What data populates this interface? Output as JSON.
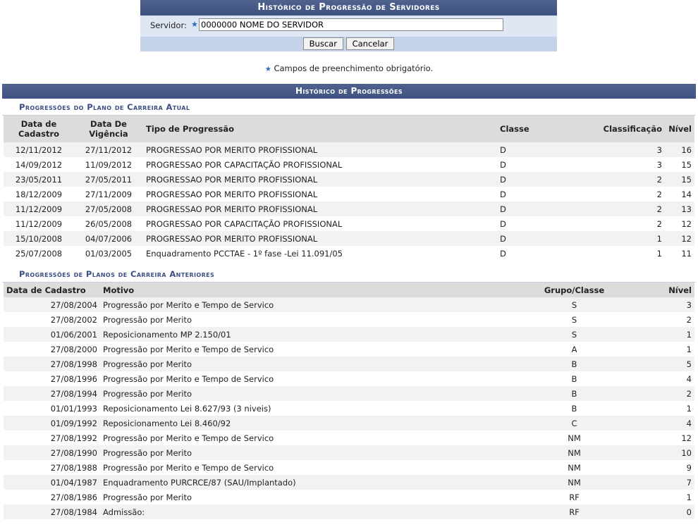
{
  "form": {
    "title": "Histórico de Progressão de Servidores",
    "servidor_label": "Servidor:",
    "servidor_value": "0000000 NOME DO SERVIDOR",
    "buscar_label": "Buscar",
    "cancelar_label": "Cancelar"
  },
  "required_note": "Campos de preenchimento obrigatório.",
  "panel": {
    "title": "Histórico de Progressões"
  },
  "atual": {
    "title": "Progressões do Plano de Carreira Atual",
    "headers": {
      "cadastro": "Data de Cadastro",
      "vigencia": "Data De Vigência",
      "tipo": "Tipo de Progressão",
      "classe": "Classe",
      "classificacao": "Classificação",
      "nivel": "Nível"
    },
    "rows": [
      {
        "cadastro": "12/11/2012",
        "vigencia": "27/11/2012",
        "tipo": "PROGRESSAO POR MERITO PROFISSIONAL",
        "classe": "D",
        "classificacao": "3",
        "nivel": "16"
      },
      {
        "cadastro": "14/09/2012",
        "vigencia": "11/09/2012",
        "tipo": "PROGRESSAO POR CAPACITAÇÃO PROFISSIONAL",
        "classe": "D",
        "classificacao": "3",
        "nivel": "15"
      },
      {
        "cadastro": "23/05/2011",
        "vigencia": "27/05/2011",
        "tipo": "PROGRESSAO POR MERITO PROFISSIONAL",
        "classe": "D",
        "classificacao": "2",
        "nivel": "15"
      },
      {
        "cadastro": "18/12/2009",
        "vigencia": "27/11/2009",
        "tipo": "PROGRESSAO POR MERITO PROFISSIONAL",
        "classe": "D",
        "classificacao": "2",
        "nivel": "14"
      },
      {
        "cadastro": "11/12/2009",
        "vigencia": "27/05/2008",
        "tipo": "PROGRESSAO POR MERITO PROFISSIONAL",
        "classe": "D",
        "classificacao": "2",
        "nivel": "13"
      },
      {
        "cadastro": "11/12/2009",
        "vigencia": "26/05/2008",
        "tipo": "PROGRESSAO POR CAPACITAÇÃO PROFISSIONAL",
        "classe": "D",
        "classificacao": "2",
        "nivel": "12"
      },
      {
        "cadastro": "15/10/2008",
        "vigencia": "04/07/2006",
        "tipo": "PROGRESSAO POR MERITO PROFISSIONAL",
        "classe": "D",
        "classificacao": "1",
        "nivel": "12"
      },
      {
        "cadastro": "25/07/2008",
        "vigencia": "01/03/2005",
        "tipo": "Enquadramento PCCTAE - 1º fase -Lei 11.091/05",
        "classe": "D",
        "classificacao": "1",
        "nivel": "11"
      }
    ]
  },
  "anteriores": {
    "title": "Progressões de Planos de Carreira Anteriores",
    "headers": {
      "cadastro": "Data de Cadastro",
      "motivo": "Motivo",
      "grupo": "Grupo/Classe",
      "nivel": "Nível"
    },
    "rows": [
      {
        "cadastro": "27/08/2004",
        "motivo": "Progressão por Merito e Tempo de Servico",
        "grupo": "S",
        "nivel": "3"
      },
      {
        "cadastro": "27/08/2002",
        "motivo": "Progressão por Merito",
        "grupo": "S",
        "nivel": "2"
      },
      {
        "cadastro": "01/06/2001",
        "motivo": "Reposicionamento MP 2.150/01",
        "grupo": "S",
        "nivel": "1"
      },
      {
        "cadastro": "27/08/2000",
        "motivo": "Progressão por Merito e Tempo de Servico",
        "grupo": "A",
        "nivel": "1"
      },
      {
        "cadastro": "27/08/1998",
        "motivo": "Progressão por Merito",
        "grupo": "B",
        "nivel": "5"
      },
      {
        "cadastro": "27/08/1996",
        "motivo": "Progressão por Merito e Tempo de Servico",
        "grupo": "B",
        "nivel": "4"
      },
      {
        "cadastro": "27/08/1994",
        "motivo": "Progressão por Merito",
        "grupo": "B",
        "nivel": "2"
      },
      {
        "cadastro": "01/01/1993",
        "motivo": "Reposicionamento Lei 8.627/93 (3 niveis)",
        "grupo": "B",
        "nivel": "1"
      },
      {
        "cadastro": "01/09/1992",
        "motivo": "Reposicionamento Lei 8.460/92",
        "grupo": "C",
        "nivel": "4"
      },
      {
        "cadastro": "27/08/1992",
        "motivo": "Progressão por Merito e Tempo de Servico",
        "grupo": "NM",
        "nivel": "12"
      },
      {
        "cadastro": "27/08/1990",
        "motivo": "Progressão por Merito",
        "grupo": "NM",
        "nivel": "10"
      },
      {
        "cadastro": "27/08/1988",
        "motivo": "Progressão por Merito e Tempo de Servico",
        "grupo": "NM",
        "nivel": "9"
      },
      {
        "cadastro": "01/04/1987",
        "motivo": "Enquadramento PURCRCE/87 (SAU/Implantado)",
        "grupo": "NM",
        "nivel": "7"
      },
      {
        "cadastro": "27/08/1986",
        "motivo": "Progressão por Merito",
        "grupo": "RF",
        "nivel": "1"
      },
      {
        "cadastro": "27/08/1984",
        "motivo": "Admissão:",
        "grupo": "RF",
        "nivel": "0"
      }
    ]
  },
  "colors": {
    "header_blue": "#3e5181",
    "form_bg": "#dee7f3",
    "button_bar": "#c4d3ea",
    "subhead_text": "#3b4f82",
    "required_star": "#2e6bbd"
  }
}
